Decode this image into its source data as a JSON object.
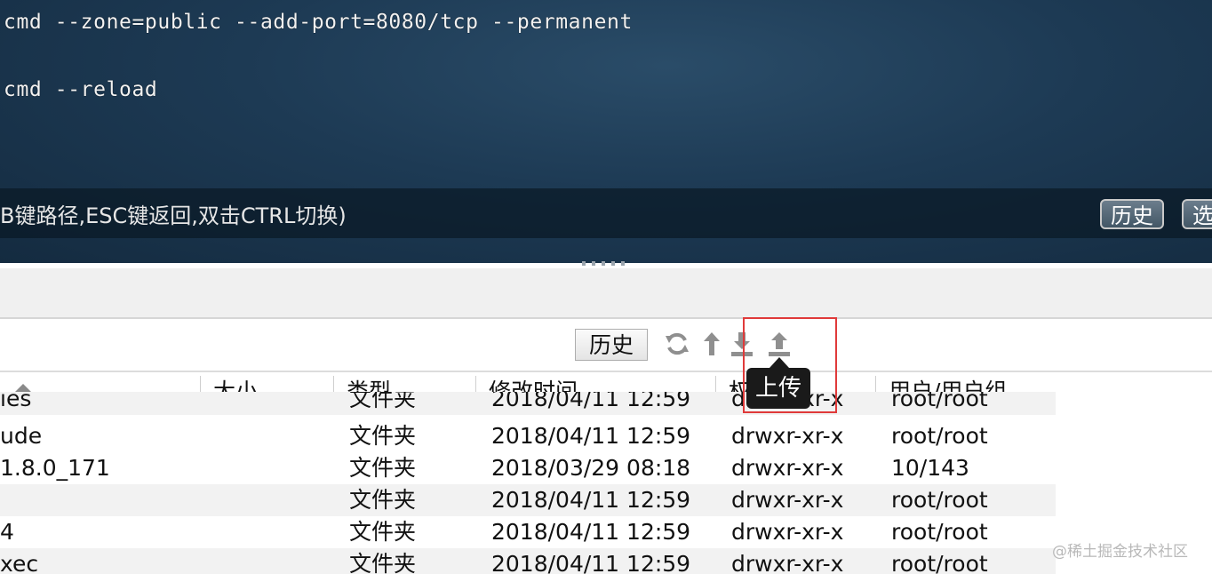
{
  "terminal": {
    "lines": [
      "cmd --zone=public --add-port=8080/tcp --permanent",
      "cmd --reload"
    ],
    "hint": "B键路径,ESC键返回,双击CTRL切换)",
    "history_button": "历史",
    "select_button": "选"
  },
  "toolbar": {
    "history_button": "历史",
    "icons": [
      "refresh-icon",
      "up-directory-icon",
      "download-icon",
      "upload-icon"
    ],
    "tooltip": "上传"
  },
  "table": {
    "columns": [
      "",
      "大小",
      "类型",
      "修改时间",
      "权限",
      "用户/用户组"
    ],
    "rows": [
      {
        "name": "ies",
        "size": "",
        "type": "文件夹",
        "modified": "2018/04/11 12:59",
        "perm": "drwxr-xr-x",
        "owner": "root/root"
      },
      {
        "name": "ude",
        "size": "",
        "type": "文件夹",
        "modified": "2018/04/11 12:59",
        "perm": "drwxr-xr-x",
        "owner": "root/root"
      },
      {
        "name": "1.8.0_171",
        "size": "",
        "type": "文件夹",
        "modified": "2018/03/29 08:18",
        "perm": "drwxr-xr-x",
        "owner": "10/143"
      },
      {
        "name": "",
        "size": "",
        "type": "文件夹",
        "modified": "2018/04/11 12:59",
        "perm": "drwxr-xr-x",
        "owner": "root/root"
      },
      {
        "name": "4",
        "size": "",
        "type": "文件夹",
        "modified": "2018/04/11 12:59",
        "perm": "drwxr-xr-x",
        "owner": "root/root"
      },
      {
        "name": "xec",
        "size": "",
        "type": "文件夹",
        "modified": "2018/04/11 12:59",
        "perm": "drwxr-xr-x",
        "owner": "root/root"
      }
    ]
  },
  "watermark": "@稀土掘金技术社区",
  "colors": {
    "highlight": "#e03a3a",
    "terminal_bg": "#1d3a54"
  }
}
